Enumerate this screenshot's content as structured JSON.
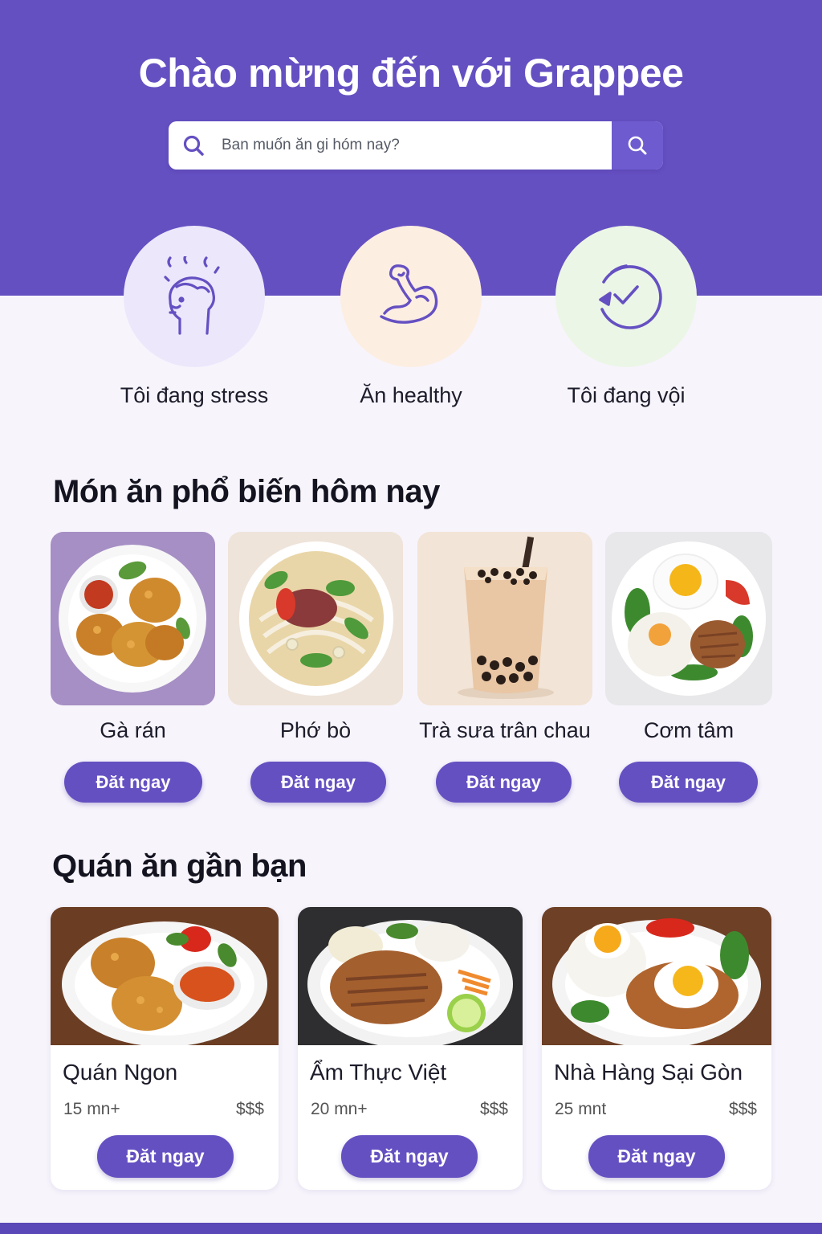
{
  "header": {
    "title": "Chào mừng đến với Grappee",
    "search": {
      "placeholder": "Ban muốn ăn gi hóm nay?",
      "value": ""
    }
  },
  "moods": [
    {
      "label": "Tôi đang stress",
      "icon": "stressed-head-icon",
      "bg": "#ece7fb"
    },
    {
      "label": "Ăn healthy",
      "icon": "flexed-arm-icon",
      "bg": "#fdeee2"
    },
    {
      "label": "Tôi đang vội",
      "icon": "clock-check-icon",
      "bg": "#ebf6e6"
    }
  ],
  "popular": {
    "title": "Món ăn phổ biến hôm nay",
    "items": [
      {
        "name": "Gà rán",
        "button": "Đăt ngay",
        "image": "fried-chicken-image"
      },
      {
        "name": "Phớ bò",
        "button": "Đăt ngay",
        "image": "beef-pho-image"
      },
      {
        "name": "Trà sưa trân chau",
        "button": "Đăt ngay",
        "image": "bubble-tea-image"
      },
      {
        "name": "Cơm tâm",
        "button": "Đăt ngay",
        "image": "broken-rice-image"
      }
    ]
  },
  "nearby": {
    "title": "Quán ăn gần bạn",
    "items": [
      {
        "name": "Quán Ngon",
        "time": "15 mn+",
        "price": "$$$",
        "button": "Đăt ngay",
        "image": "fried-chicken-plate-image"
      },
      {
        "name": "Ẩm Thực Việt",
        "time": "20 mn+",
        "price": "$$$",
        "button": "Đăt ngay",
        "image": "grilled-pork-plate-image"
      },
      {
        "name": "Nhà Hàng Sại Gòn",
        "time": "25 mnt",
        "price": "$$$",
        "button": "Đăt ngay",
        "image": "egg-pork-plate-image"
      }
    ]
  },
  "colors": {
    "primary": "#6550c2",
    "button": "#6f5bd0",
    "background": "#f7f4fc"
  }
}
